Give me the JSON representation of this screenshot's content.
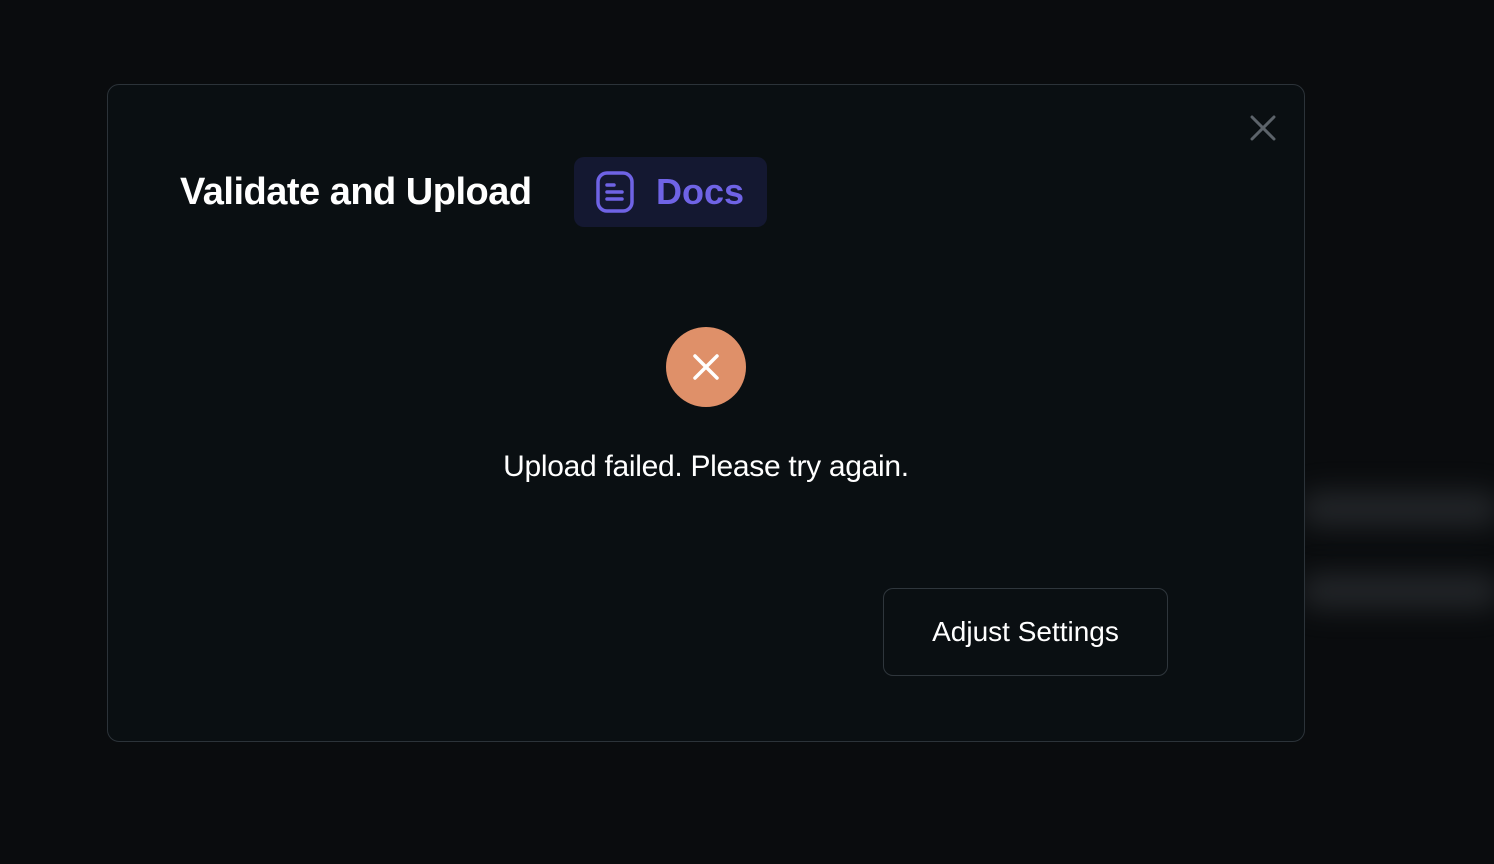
{
  "modal": {
    "title": "Validate and Upload",
    "docs_button": {
      "label": "Docs",
      "icon": "document-icon",
      "color": "#6f63e5",
      "background": "#141831"
    },
    "close_icon": "close-icon",
    "status": {
      "icon": "error-x-icon",
      "color": "#df9069",
      "message": "Upload failed. Please try again."
    },
    "actions": {
      "adjust_settings_label": "Adjust Settings"
    }
  }
}
